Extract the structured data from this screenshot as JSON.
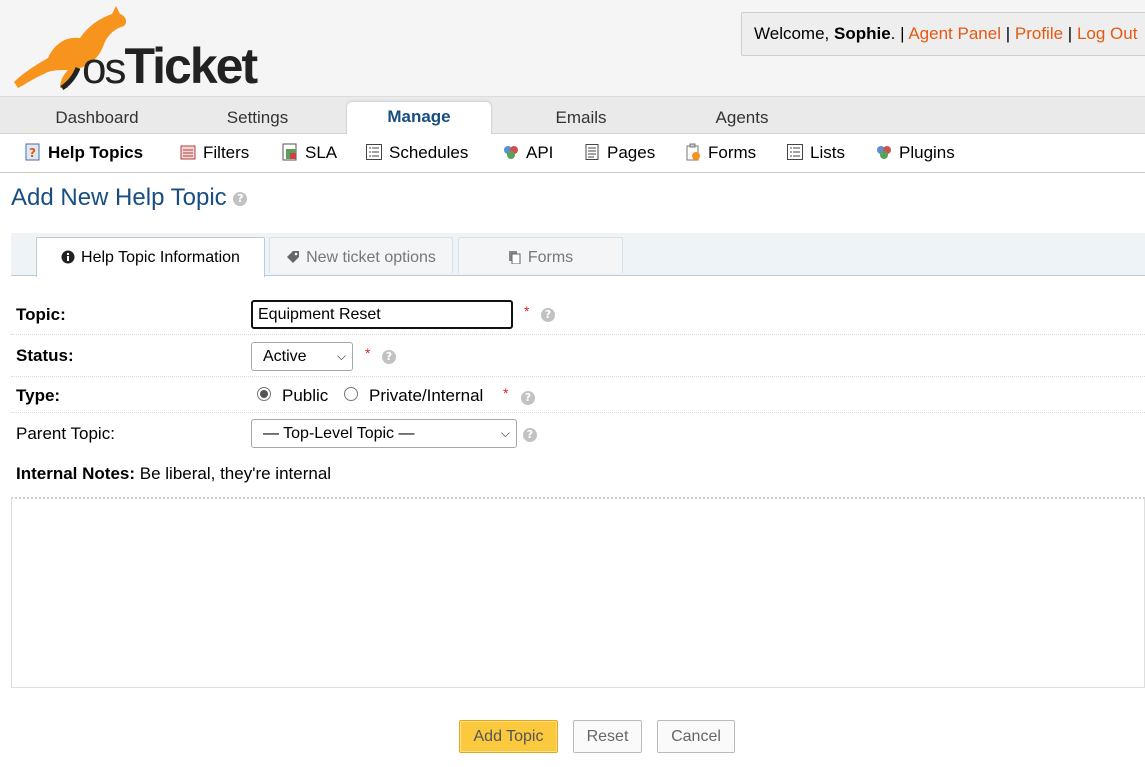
{
  "header": {
    "welcome_prefix": "Welcome, ",
    "user_name": "Sophie",
    "welcome_suffix": ". |",
    "links": [
      "Agent Panel",
      "Profile",
      "Log Out"
    ],
    "separator": "|"
  },
  "nav": {
    "tabs": [
      {
        "label": "Dashboard"
      },
      {
        "label": "Settings"
      },
      {
        "label": "Manage",
        "active": true
      },
      {
        "label": "Emails"
      },
      {
        "label": "Agents"
      }
    ]
  },
  "subnav": {
    "items": [
      {
        "label": "Help Topics",
        "icon": "help-topics-icon",
        "active": true
      },
      {
        "label": "Filters",
        "icon": "filters-icon"
      },
      {
        "label": "SLA",
        "icon": "sla-icon"
      },
      {
        "label": "Schedules",
        "icon": "schedules-icon"
      },
      {
        "label": "API",
        "icon": "api-icon"
      },
      {
        "label": "Pages",
        "icon": "pages-icon"
      },
      {
        "label": "Forms",
        "icon": "forms-icon"
      },
      {
        "label": "Lists",
        "icon": "lists-icon"
      },
      {
        "label": "Plugins",
        "icon": "plugins-icon"
      }
    ]
  },
  "page": {
    "title": "Add New Help Topic"
  },
  "form_tabs": [
    {
      "label": "Help Topic Information",
      "active": true
    },
    {
      "label": "New ticket options"
    },
    {
      "label": "Forms"
    }
  ],
  "form": {
    "topic_label": "Topic:",
    "topic_value": "Equipment Reset",
    "status_label": "Status:",
    "status_value": "Active",
    "type_label": "Type:",
    "type_options": [
      "Public",
      "Private/Internal"
    ],
    "type_selected": "Public",
    "parent_label": "Parent Topic:",
    "parent_value": "— Top-Level Topic —",
    "notes_label": "Internal Notes:",
    "notes_hint": "Be liberal, they're internal",
    "required_mark": "*"
  },
  "buttons": {
    "add": "Add Topic",
    "reset": "Reset",
    "cancel": "Cancel"
  },
  "colors": {
    "accent_link": "#e35a13",
    "title_blue": "#184e81",
    "primary_button": "#fbc93e",
    "logo_orange": "#f7941d"
  }
}
